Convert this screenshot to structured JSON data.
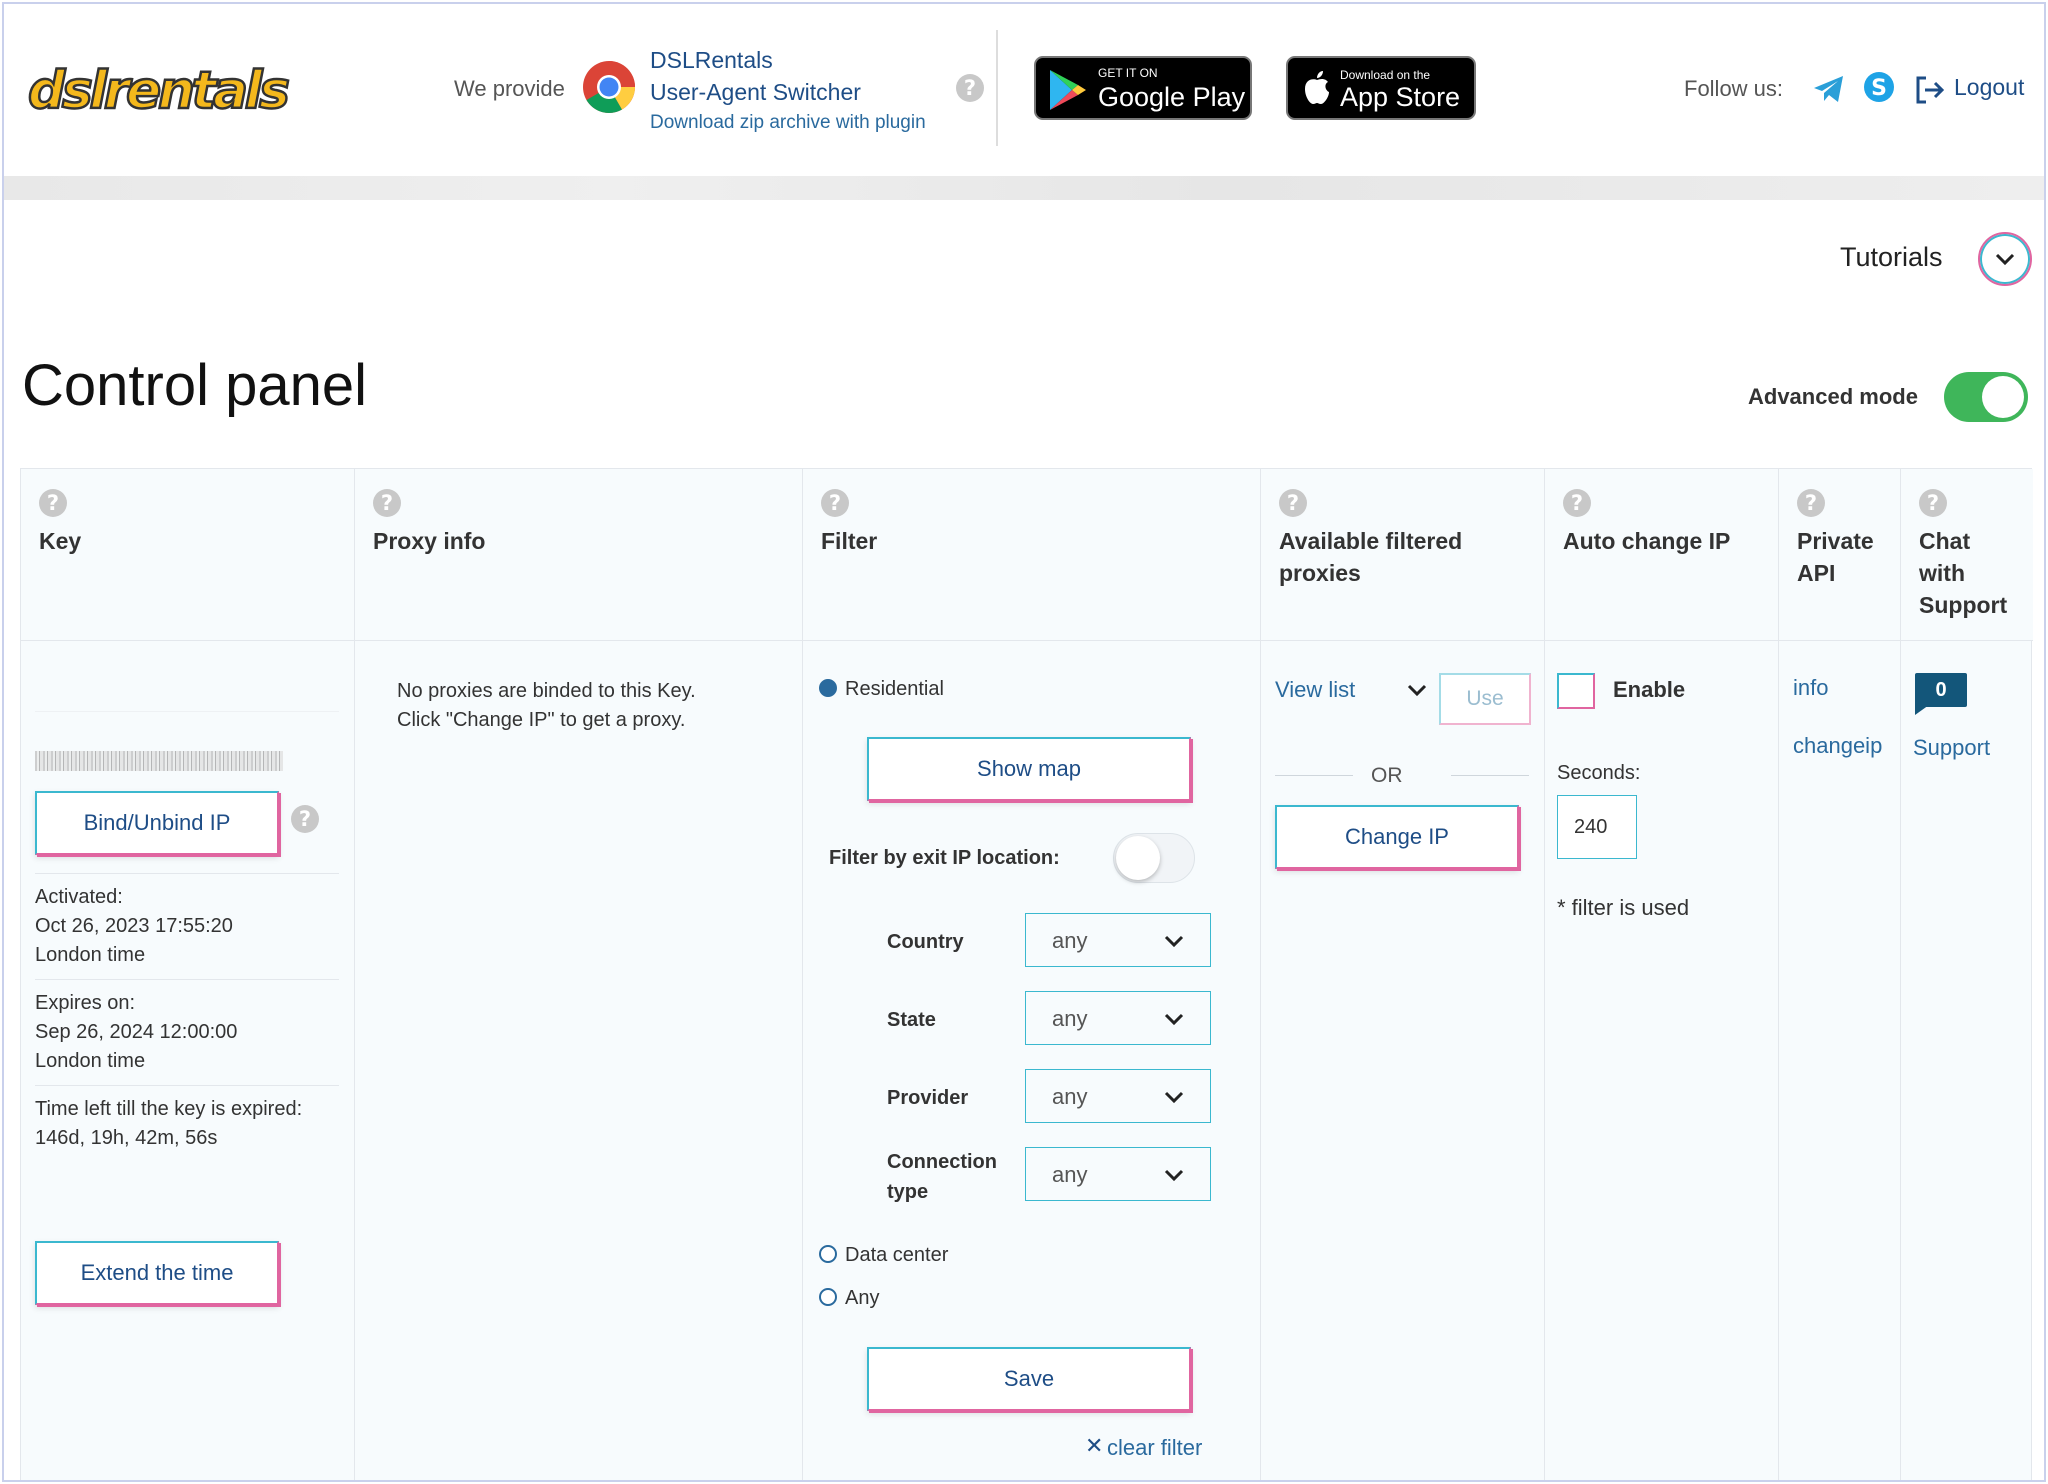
{
  "header": {
    "logo_text": "dslrentals",
    "we_provide": "We provide",
    "plugin_line1": "DSLRentals",
    "plugin_line2": "User-Agent Switcher",
    "plugin_line3": "Download zip archive with plugin",
    "gplay_small": "GET IT ON",
    "gplay_big": "Google Play",
    "astore_small": "Download on the",
    "astore_big": "App Store",
    "follow_us": "Follow us:",
    "logout": "Logout"
  },
  "tutorials": "Tutorials",
  "page_title": "Control panel",
  "advanced_mode": {
    "label": "Advanced mode",
    "enabled": true
  },
  "columns": {
    "key": "Key",
    "proxy_info": "Proxy info",
    "filter": "Filter",
    "available": "Available filtered proxies",
    "auto_change": "Auto change IP",
    "private_api": "Private API",
    "chat": "Chat with Support"
  },
  "key": {
    "bind_button": "Bind/Unbind IP",
    "activated_label": "Activated:",
    "activated_date": "Oct 26, 2023 17:55:20",
    "activated_tz": "London time",
    "expires_label": "Expires on:",
    "expires_date": "Sep 26, 2024 12:00:00",
    "expires_tz": "London time",
    "time_left_label": "Time left till the key is expired:",
    "time_left_value": "146d, 19h, 42m, 56s",
    "extend_button": "Extend the time"
  },
  "proxy_info": {
    "line1": "No proxies are binded to this Key.",
    "line2": "Click \"Change IP\" to get a proxy."
  },
  "filter": {
    "residential": "Residential",
    "show_map": "Show map",
    "exit_ip_label": "Filter by exit IP location:",
    "country_label": "Country",
    "country_value": "any",
    "state_label": "State",
    "state_value": "any",
    "provider_label": "Provider",
    "provider_value": "any",
    "conn_label_1": "Connection",
    "conn_label_2": "type",
    "conn_value": "any",
    "data_center": "Data center",
    "any": "Any",
    "save": "Save",
    "clear": "clear filter"
  },
  "available": {
    "view_list": "View list",
    "use": "Use",
    "or": "OR",
    "change_ip": "Change IP"
  },
  "auto_change": {
    "enable": "Enable",
    "seconds_label": "Seconds:",
    "seconds_value": "240",
    "note": "* filter is used"
  },
  "private_api": {
    "info": "info",
    "changeip": "changeip"
  },
  "chat": {
    "badge": "0",
    "support": "Support"
  },
  "colors": {
    "accent_cyan": "#3bb8cf",
    "accent_pink": "#e065a0",
    "link_blue": "#1e4d86",
    "toggle_green": "#3fb65a"
  }
}
